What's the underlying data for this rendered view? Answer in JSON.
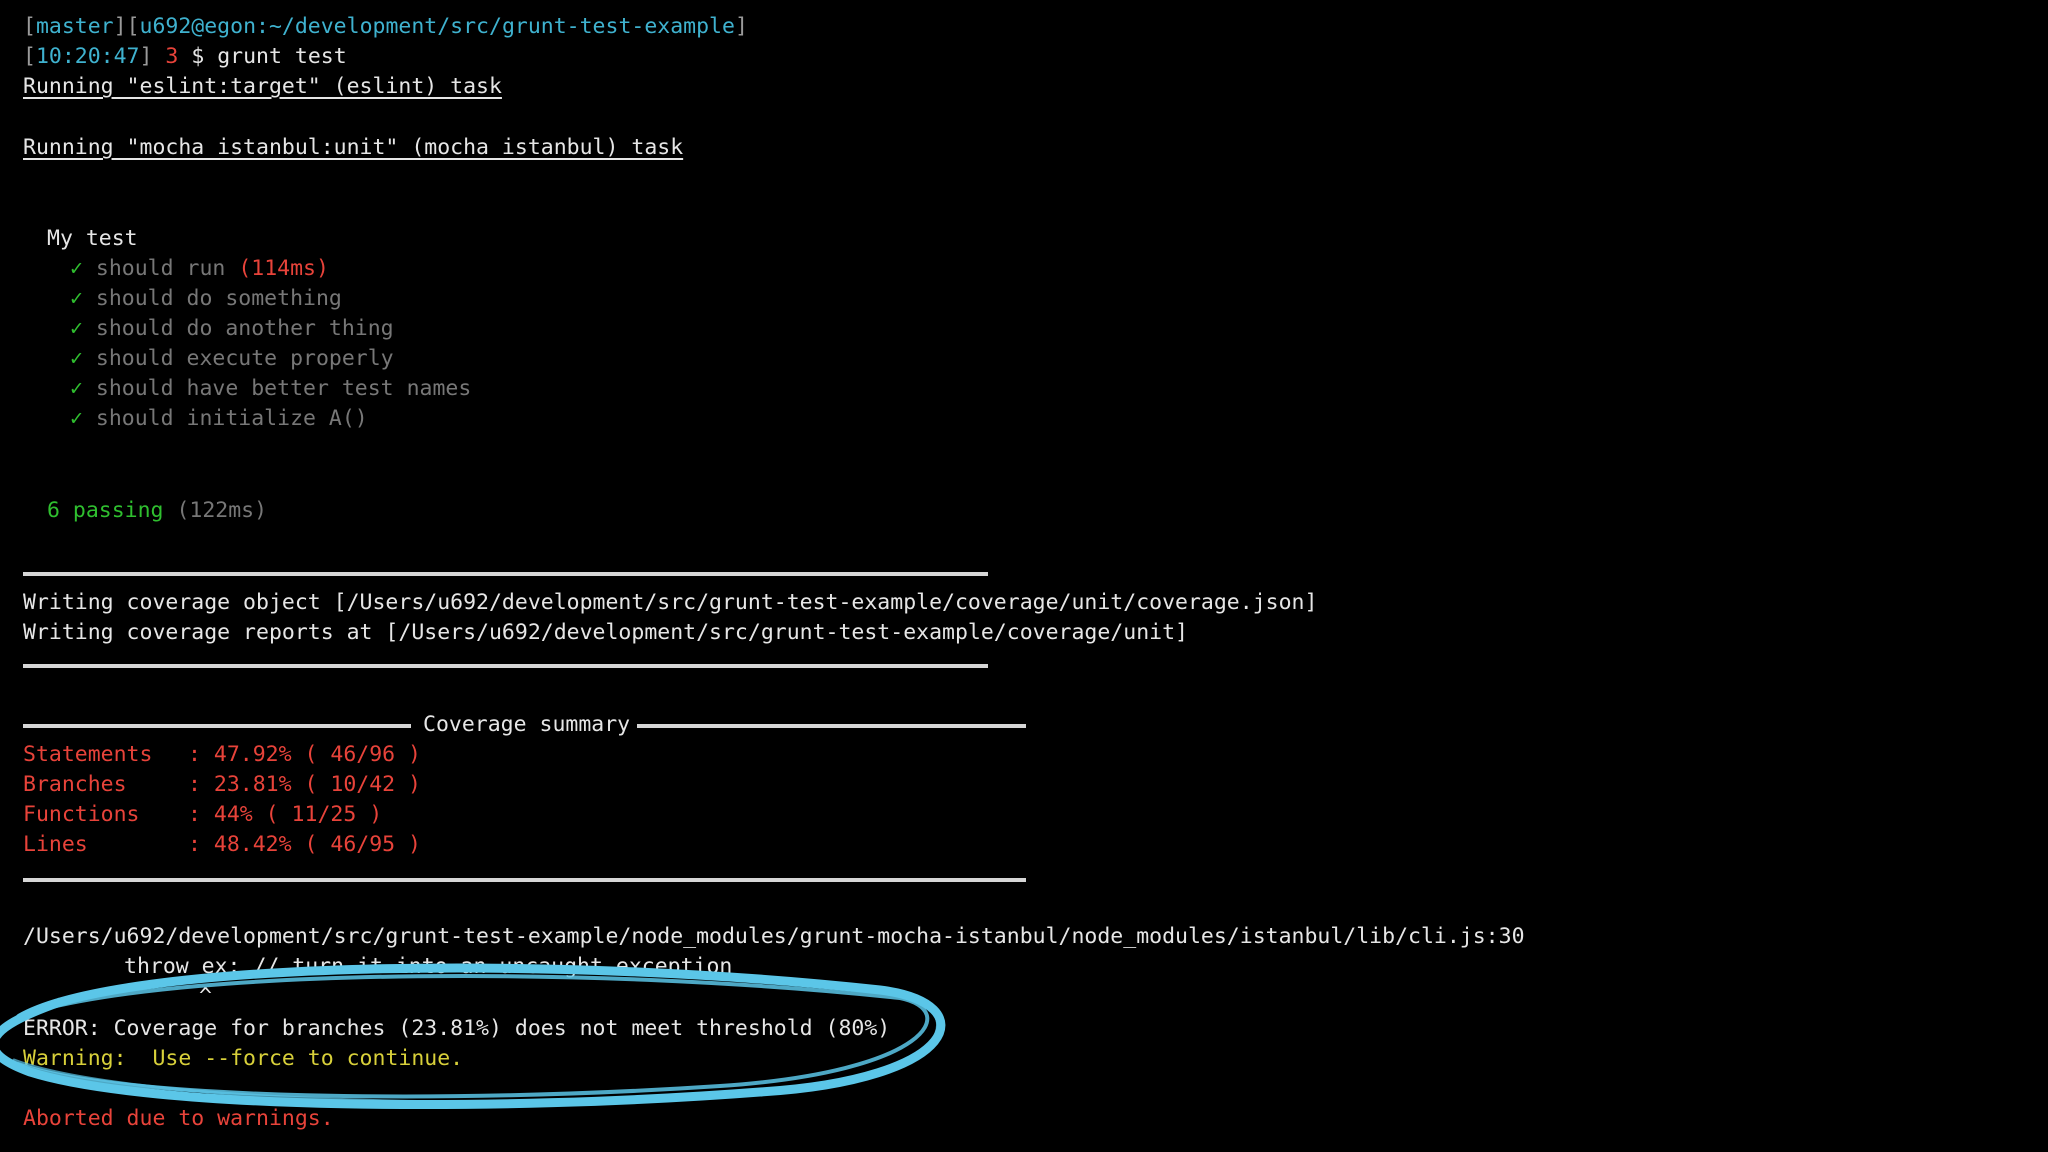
{
  "prompt": {
    "open1": "[",
    "branch": "master",
    "close1": "][",
    "user_host": "u692@egon:~/development/src/grunt-test-example",
    "close2": "]",
    "time": "10:20:47",
    "count": "3",
    "command": "$ grunt test"
  },
  "tasks": {
    "eslint": "Running \"eslint:target\" (eslint) task",
    "mocha": "Running \"mocha_istanbul:unit\" (mocha_istanbul) task"
  },
  "suite": {
    "title": "My test",
    "check_glyph": "✓",
    "tests": [
      {
        "name": "should run",
        "time": "(114ms)"
      },
      {
        "name": "should do something"
      },
      {
        "name": "should do another thing"
      },
      {
        "name": "should execute properly"
      },
      {
        "name": "should have better test names"
      },
      {
        "name": "should initialize A()"
      }
    ],
    "passing": "6 passing",
    "passing_time": "(122ms)"
  },
  "coverage_files": {
    "object": "Writing coverage object [/Users/u692/development/src/grunt-test-example/coverage/unit/coverage.json]",
    "reports": "Writing coverage reports at [/Users/u692/development/src/grunt-test-example/coverage/unit]"
  },
  "summary": {
    "title": "Coverage summary",
    "rows": [
      {
        "label": "Statements",
        "value": ": 47.92% ( 46/96 )"
      },
      {
        "label": "Branches",
        "value": ": 23.81% ( 10/42 )"
      },
      {
        "label": "Functions",
        "value": ": 44% ( 11/25 )"
      },
      {
        "label": "Lines",
        "value": ": 48.42% ( 46/95 )"
      }
    ]
  },
  "trace": {
    "path": "/Users/u692/development/src/grunt-test-example/node_modules/grunt-mocha-istanbul/node_modules/istanbul/lib/cli.js:30",
    "code": "throw ex; // turn it into an uncaught exception",
    "caret": "^"
  },
  "errors": {
    "error": "ERROR: Coverage for branches (23.81%) does not meet threshold (80%)",
    "warning_label": "Warning:",
    "warning_text": "Use --force to continue.",
    "aborted": "Aborted due to warnings."
  },
  "colors": {
    "background": "#000000",
    "prompt_cyan": "#3fb2cf",
    "error_red": "#e8433a",
    "pass_green": "#2fbf2f",
    "warning_yellow": "#d8d03a",
    "highlight_ellipse": "#5bc6e8"
  }
}
